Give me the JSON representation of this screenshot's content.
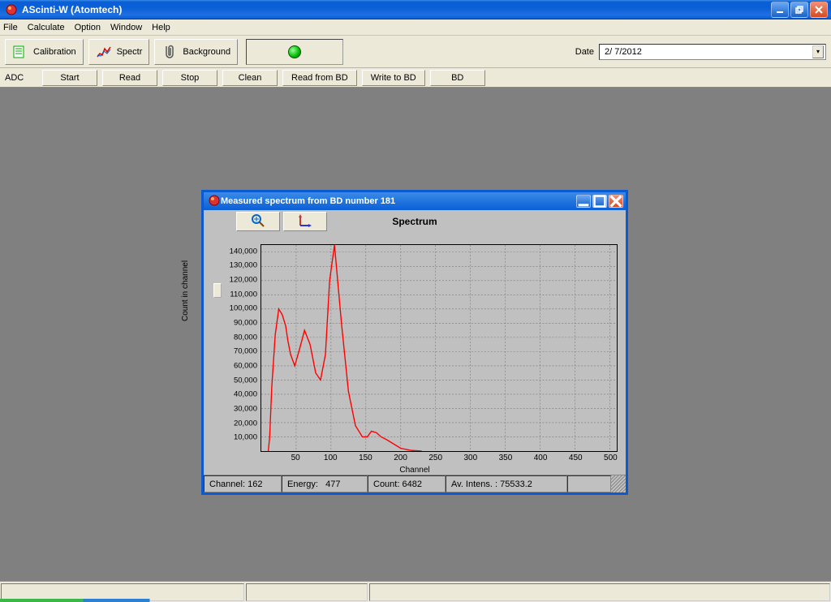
{
  "app": {
    "title": "AScinti-W  (Atomtech)"
  },
  "menu": {
    "items": [
      "File",
      "Calculate",
      "Option",
      "Window",
      "Help"
    ]
  },
  "toolbar": {
    "calibration": "Calibration",
    "spectr": "Spectr",
    "background": "Background",
    "date_label": "Date",
    "date_value": "  2/  7/2012"
  },
  "adc": {
    "label": "ADC",
    "buttons": [
      "Start",
      "Read",
      "Stop",
      "Clean",
      "Read from BD",
      "Write to BD",
      "BD"
    ]
  },
  "child": {
    "title": "Measured spectrum from BD number 181",
    "plot_title": "Spectrum",
    "ylabel": "Count in channel",
    "xlabel": "Channel",
    "status": {
      "channel_label": "Channel:",
      "channel_value": "162",
      "energy_label": "Energy:",
      "energy_value": "477",
      "count_label": "Count:",
      "count_value": "6482",
      "intens_label": "Av. Intens. :",
      "intens_value": "75533.2"
    }
  },
  "chart_data": {
    "type": "line",
    "title": "Spectrum",
    "xlabel": "Channel",
    "ylabel": "Count in channel",
    "xlim": [
      0,
      510
    ],
    "ylim": [
      0,
      145000
    ],
    "xticks": [
      50,
      100,
      150,
      200,
      250,
      300,
      350,
      400,
      450,
      500
    ],
    "yticks": [
      10000,
      20000,
      30000,
      40000,
      50000,
      60000,
      70000,
      80000,
      90000,
      100000,
      110000,
      120000,
      130000,
      140000
    ],
    "ytick_labels": [
      "10,000",
      "20,000",
      "30,000",
      "40,000",
      "50,000",
      "60,000",
      "70,000",
      "80,000",
      "90,000",
      "100,000",
      "110,000",
      "120,000",
      "130,000",
      "140,000"
    ],
    "series": [
      {
        "name": "Spectrum",
        "color": "#ff0000",
        "x": [
          10,
          12,
          15,
          20,
          25,
          30,
          35,
          38,
          42,
          48,
          55,
          62,
          70,
          78,
          85,
          92,
          98,
          105,
          115,
          125,
          135,
          145,
          152,
          158,
          165,
          172,
          180,
          190,
          200,
          215,
          230
        ],
        "values": [
          0,
          10000,
          45000,
          82000,
          100000,
          96000,
          88000,
          78000,
          68000,
          60000,
          72000,
          85000,
          75000,
          55000,
          50000,
          68000,
          120000,
          145000,
          90000,
          42000,
          18000,
          10000,
          10000,
          14000,
          13000,
          10000,
          8000,
          5000,
          2000,
          500,
          0
        ]
      }
    ]
  }
}
